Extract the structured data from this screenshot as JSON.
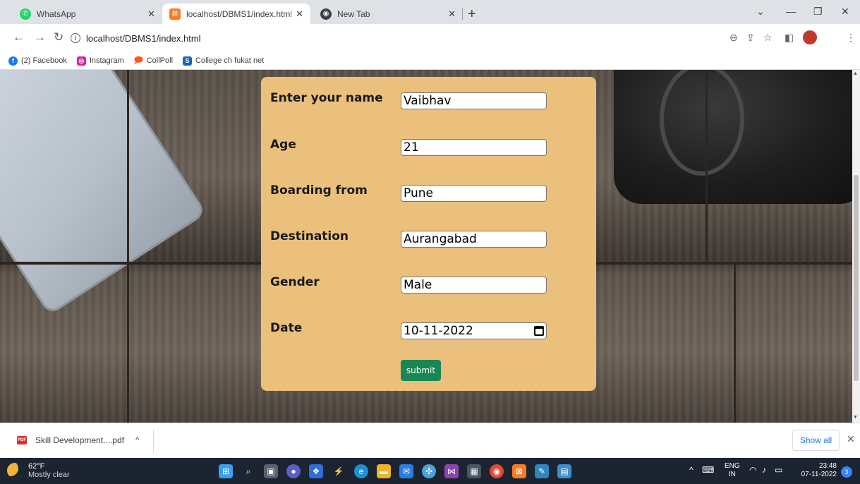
{
  "browser": {
    "tabs": [
      {
        "title": "WhatsApp",
        "active": false,
        "icon": "whatsapp-icon",
        "color": "#25d366"
      },
      {
        "title": "localhost/DBMS1/index.html",
        "active": true,
        "icon": "xampp-icon",
        "color": "#fb7a24"
      },
      {
        "title": "New Tab",
        "active": false,
        "icon": "chrome-icon",
        "color": "#3c4043"
      }
    ],
    "url": "localhost/DBMS1/index.html",
    "bookmarks": [
      {
        "label": "(2) Facebook",
        "icon": "facebook-icon",
        "color": "#1877f2"
      },
      {
        "label": "Instagram",
        "icon": "instagram-icon",
        "color": "#d6249f"
      },
      {
        "label": "CollPoll",
        "icon": "chat-icon",
        "color": "#ff5722"
      },
      {
        "label": "College ch fukat net",
        "icon": "s-icon",
        "color": "#1565c0"
      }
    ]
  },
  "form": {
    "fields": [
      {
        "label": "Enter your name",
        "value": "Vaibhav"
      },
      {
        "label": "Age",
        "value": "21"
      },
      {
        "label": "Boarding from",
        "value": "Pune"
      },
      {
        "label": "Destination",
        "value": "Aurangabad"
      },
      {
        "label": "Gender",
        "value": "Male"
      },
      {
        "label": "Date",
        "value": "10-11-2022"
      }
    ],
    "submit_label": "submit",
    "card_color": "#ebc07c",
    "submit_color": "#198754"
  },
  "downloads": {
    "file": "Skill Development....pdf",
    "show_all": "Show all"
  },
  "taskbar": {
    "temperature": "62°F",
    "weather": "Mostly clear",
    "lang": "ENG",
    "region": "IN",
    "time": "23:48",
    "date": "07-11-2022",
    "notifications": "3"
  }
}
